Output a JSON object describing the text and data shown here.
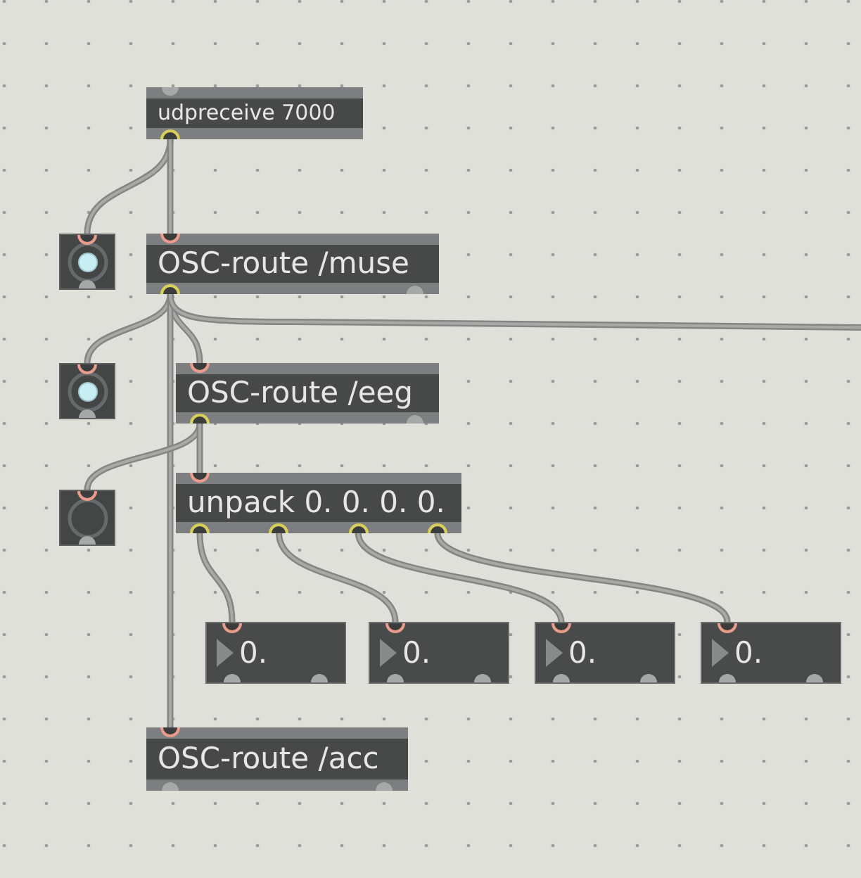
{
  "objects": [
    {
      "kind": "object",
      "text": "udpreceive 7000",
      "inlets": [
        {
          "connected": false
        }
      ],
      "outlets": [
        {
          "connected": true
        }
      ]
    },
    {
      "kind": "bang",
      "lit": true,
      "inlets": [
        {
          "connected": true
        }
      ],
      "outlets": [
        {
          "connected": false
        }
      ]
    },
    {
      "kind": "object",
      "text": "OSC-route /muse",
      "inlets": [
        {
          "connected": true
        }
      ],
      "outlets": [
        {
          "connected": true
        },
        {
          "connected": false
        }
      ]
    },
    {
      "kind": "bang",
      "lit": true,
      "inlets": [
        {
          "connected": true
        }
      ],
      "outlets": [
        {
          "connected": false
        }
      ]
    },
    {
      "kind": "object",
      "text": "OSC-route /eeg",
      "inlets": [
        {
          "connected": true
        }
      ],
      "outlets": [
        {
          "connected": true
        },
        {
          "connected": false
        }
      ]
    },
    {
      "kind": "bang",
      "lit": false,
      "inlets": [
        {
          "connected": true
        }
      ],
      "outlets": [
        {
          "connected": false
        }
      ]
    },
    {
      "kind": "object",
      "text": "unpack 0. 0. 0. 0.",
      "inlets": [
        {
          "connected": true
        }
      ],
      "outlets": [
        {
          "connected": true
        },
        {
          "connected": true
        },
        {
          "connected": true
        },
        {
          "connected": true
        }
      ]
    },
    {
      "kind": "number",
      "value": "0.",
      "inlets": [
        {
          "connected": true
        }
      ],
      "outlets": [
        {
          "connected": false
        },
        {
          "connected": false
        }
      ]
    },
    {
      "kind": "number",
      "value": "0.",
      "inlets": [
        {
          "connected": true
        }
      ],
      "outlets": [
        {
          "connected": false
        },
        {
          "connected": false
        }
      ]
    },
    {
      "kind": "number",
      "value": "0.",
      "inlets": [
        {
          "connected": true
        }
      ],
      "outlets": [
        {
          "connected": false
        },
        {
          "connected": false
        }
      ]
    },
    {
      "kind": "number",
      "value": "0.",
      "inlets": [
        {
          "connected": true
        }
      ],
      "outlets": [
        {
          "connected": false
        },
        {
          "connected": false
        }
      ]
    },
    {
      "kind": "object",
      "text": "OSC-route /acc",
      "inlets": [
        {
          "connected": true
        }
      ],
      "outlets": [
        {
          "connected": false
        },
        {
          "connected": false
        }
      ]
    }
  ]
}
